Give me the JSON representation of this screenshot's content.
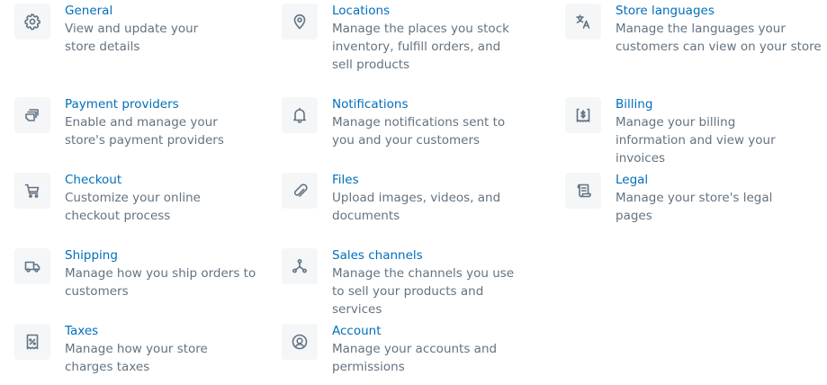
{
  "settings": {
    "general": {
      "title": "General",
      "desc": "View and update your store details",
      "icon": "gear-icon"
    },
    "payment": {
      "title": "Payment providers",
      "desc": "Enable and manage your store's payment providers",
      "icon": "payment-icon"
    },
    "checkout": {
      "title": "Checkout",
      "desc": "Customize your online checkout process",
      "icon": "cart-icon"
    },
    "shipping": {
      "title": "Shipping",
      "desc": "Manage how you ship orders to customers",
      "icon": "truck-icon"
    },
    "taxes": {
      "title": "Taxes",
      "desc": "Manage how your store charges taxes",
      "icon": "tax-receipt-icon"
    },
    "locations": {
      "title": "Locations",
      "desc": "Manage the places you stock inventory, fulfill orders, and sell products",
      "icon": "location-pin-icon"
    },
    "notifications": {
      "title": "Notifications",
      "desc": "Manage notifications sent to you and your customers",
      "icon": "bell-icon"
    },
    "files": {
      "title": "Files",
      "desc": "Upload images, videos, and documents",
      "icon": "paperclip-icon"
    },
    "sales_channels": {
      "title": "Sales channels",
      "desc": "Manage the channels you use to sell your products and services",
      "icon": "channels-icon"
    },
    "account": {
      "title": "Account",
      "desc": "Manage your accounts and permissions",
      "icon": "user-circle-icon"
    },
    "store_languages": {
      "title": "Store languages",
      "desc": "Manage the languages your customers can view on your store",
      "icon": "translate-icon"
    },
    "billing": {
      "title": "Billing",
      "desc": "Manage your billing information and view your invoices",
      "icon": "billing-icon"
    },
    "legal": {
      "title": "Legal",
      "desc": "Manage your store's legal pages",
      "icon": "legal-document-icon"
    }
  },
  "colors": {
    "link": "#006fbb",
    "text": "#637381",
    "icon_bg": "#f4f6f8"
  }
}
